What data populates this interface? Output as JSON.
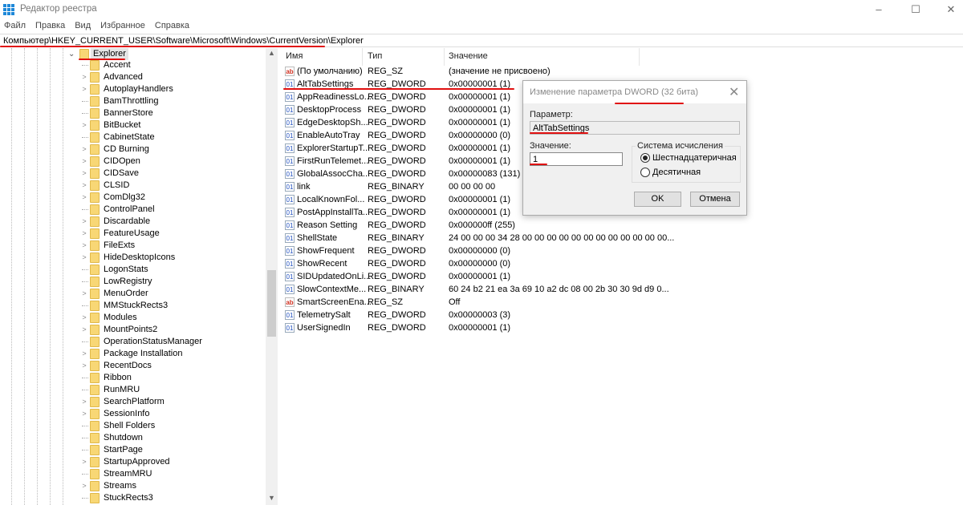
{
  "window": {
    "title": "Редактор реестра",
    "minimize_icon": "–",
    "maximize_icon": "☐",
    "close_icon": "✕"
  },
  "menu": [
    "Файл",
    "Правка",
    "Вид",
    "Избранное",
    "Справка"
  ],
  "address": "Компьютер\\HKEY_CURRENT_USER\\Software\\Microsoft\\Windows\\CurrentVersion\\Explorer",
  "tree": {
    "selected": "Explorer",
    "children": [
      {
        "label": "Accent",
        "exp": false
      },
      {
        "label": "Advanced",
        "exp": true
      },
      {
        "label": "AutoplayHandlers",
        "exp": true
      },
      {
        "label": "BamThrottling",
        "exp": false
      },
      {
        "label": "BannerStore",
        "exp": false
      },
      {
        "label": "BitBucket",
        "exp": true
      },
      {
        "label": "CabinetState",
        "exp": false
      },
      {
        "label": "CD Burning",
        "exp": true
      },
      {
        "label": "CIDOpen",
        "exp": true
      },
      {
        "label": "CIDSave",
        "exp": true
      },
      {
        "label": "CLSID",
        "exp": true
      },
      {
        "label": "ComDlg32",
        "exp": true
      },
      {
        "label": "ControlPanel",
        "exp": false
      },
      {
        "label": "Discardable",
        "exp": true
      },
      {
        "label": "FeatureUsage",
        "exp": true
      },
      {
        "label": "FileExts",
        "exp": true
      },
      {
        "label": "HideDesktopIcons",
        "exp": true
      },
      {
        "label": "LogonStats",
        "exp": false
      },
      {
        "label": "LowRegistry",
        "exp": false
      },
      {
        "label": "MenuOrder",
        "exp": true
      },
      {
        "label": "MMStuckRects3",
        "exp": false
      },
      {
        "label": "Modules",
        "exp": true
      },
      {
        "label": "MountPoints2",
        "exp": true
      },
      {
        "label": "OperationStatusManager",
        "exp": false
      },
      {
        "label": "Package Installation",
        "exp": true
      },
      {
        "label": "RecentDocs",
        "exp": true
      },
      {
        "label": "Ribbon",
        "exp": false
      },
      {
        "label": "RunMRU",
        "exp": false
      },
      {
        "label": "SearchPlatform",
        "exp": true
      },
      {
        "label": "SessionInfo",
        "exp": true
      },
      {
        "label": "Shell Folders",
        "exp": false
      },
      {
        "label": "Shutdown",
        "exp": false
      },
      {
        "label": "StartPage",
        "exp": false
      },
      {
        "label": "StartupApproved",
        "exp": true
      },
      {
        "label": "StreamMRU",
        "exp": false
      },
      {
        "label": "Streams",
        "exp": true
      },
      {
        "label": "StuckRects3",
        "exp": false
      }
    ]
  },
  "list": {
    "headers": [
      "Имя",
      "Тип",
      "Значение"
    ],
    "rows": [
      [
        "(По умолчанию)",
        "REG_SZ",
        "(значение не присвоено)"
      ],
      [
        "AltTabSettings",
        "REG_DWORD",
        "0x00000001 (1)"
      ],
      [
        "AppReadinessLo...",
        "REG_DWORD",
        "0x00000001 (1)"
      ],
      [
        "DesktopProcess",
        "REG_DWORD",
        "0x00000001 (1)"
      ],
      [
        "EdgeDesktopSh...",
        "REG_DWORD",
        "0x00000001 (1)"
      ],
      [
        "EnableAutoTray",
        "REG_DWORD",
        "0x00000000 (0)"
      ],
      [
        "ExplorerStartupT...",
        "REG_DWORD",
        "0x00000001 (1)"
      ],
      [
        "FirstRunTelemet...",
        "REG_DWORD",
        "0x00000001 (1)"
      ],
      [
        "GlobalAssocCha...",
        "REG_DWORD",
        "0x00000083 (131)"
      ],
      [
        "link",
        "REG_BINARY",
        "00 00 00 00"
      ],
      [
        "LocalKnownFol...",
        "REG_DWORD",
        "0x00000001 (1)"
      ],
      [
        "PostAppInstallTa...",
        "REG_DWORD",
        "0x00000001 (1)"
      ],
      [
        "Reason Setting",
        "REG_DWORD",
        "0x000000ff (255)"
      ],
      [
        "ShellState",
        "REG_BINARY",
        "24 00 00 00 34 28 00 00 00 00 00 00 00 00 00 00 00 00..."
      ],
      [
        "ShowFrequent",
        "REG_DWORD",
        "0x00000000 (0)"
      ],
      [
        "ShowRecent",
        "REG_DWORD",
        "0x00000000 (0)"
      ],
      [
        "SIDUpdatedOnLi...",
        "REG_DWORD",
        "0x00000001 (1)"
      ],
      [
        "SlowContextMe...",
        "REG_BINARY",
        "60 24 b2 21 ea 3a 69 10 a2 dc 08 00 2b 30 30 9d d9 0..."
      ],
      [
        "SmartScreenEna...",
        "REG_SZ",
        "Off"
      ],
      [
        "TelemetrySalt",
        "REG_DWORD",
        "0x00000003 (3)"
      ],
      [
        "UserSignedIn",
        "REG_DWORD",
        "0x00000001 (1)"
      ]
    ]
  },
  "dialog": {
    "title": "Изменение параметра DWORD (32 бита)",
    "param_label": "Параметр:",
    "param_value": "AltTabSettings",
    "value_label": "Значение:",
    "value": "1",
    "base_group": "Система исчисления",
    "hex": "Шестнадцатеричная",
    "dec": "Десятичная",
    "selected_base": "hex",
    "ok": "OK",
    "cancel": "Отмена",
    "close_icon": "✕"
  },
  "colors": {
    "annotation": "#e01010",
    "folder": "#f8d775"
  }
}
